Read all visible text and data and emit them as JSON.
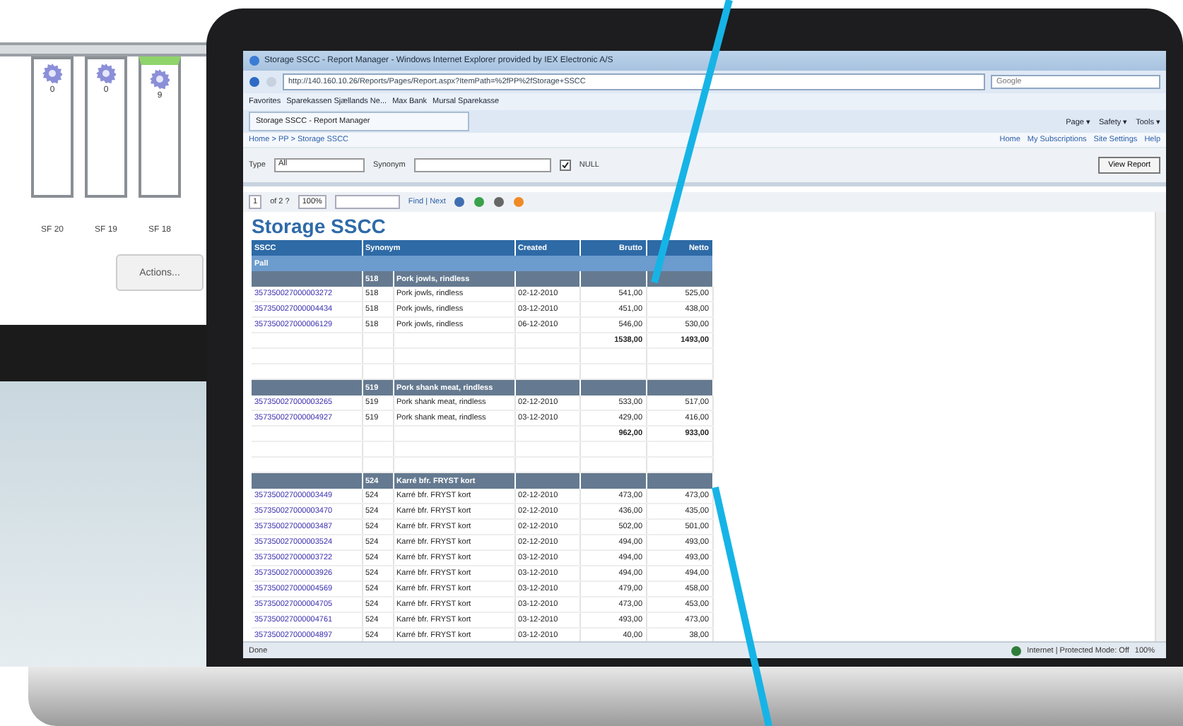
{
  "monitor": {
    "slots": [
      {
        "label": "SF 20",
        "count": "0",
        "selected": false
      },
      {
        "label": "SF 19",
        "count": "0",
        "selected": false
      },
      {
        "label": "SF 18",
        "count": "9",
        "selected": true
      }
    ],
    "actions_button": "Actions..."
  },
  "browser": {
    "title": "Storage SSCC - Report Manager - Windows Internet Explorer provided by IEX Electronic A/S",
    "address": "http://140.160.10.26/Reports/Pages/Report.aspx?ItemPath=%2fPP%2fStorage+SSCC",
    "search_placeholder": "Google",
    "favorites": [
      "Favorites",
      "Sparekassen Sjællands Ne...",
      "Max Bank",
      "Mursal Sparekasse"
    ],
    "tab": "Storage SSCC - Report Manager",
    "commands": [
      "Page ▾",
      "Safety ▾",
      "Tools ▾"
    ],
    "breadcrumb": "Home > PP > Storage SSCC",
    "links": [
      "Home",
      "My Subscriptions",
      "Site Settings",
      "Help"
    ],
    "params": {
      "type_label": "Type",
      "type_value": "All",
      "synonym_label": "Synonym",
      "null_label": "NULL",
      "null_checked": true,
      "view_button": "View Report"
    },
    "report_toolbar": {
      "page": "1",
      "of": "of 2 ?",
      "zoom": "100%",
      "find": "Find | Next"
    },
    "status": {
      "left": "Done",
      "zone": "Internet | Protected Mode: Off",
      "zoom": "100%"
    }
  },
  "report": {
    "title": "Storage SSCC",
    "columns": [
      "SSCC",
      "Synonym",
      "Created",
      "Brutto",
      "Netto"
    ],
    "group": "Pall",
    "subgroups": [
      {
        "code": "518",
        "name": "Pork jowls, rindless",
        "total": [
          "1538,00",
          "1493,00"
        ],
        "rows": [
          [
            "357350027000003272",
            "518",
            "Pork jowls, rindless",
            "02-12-2010",
            "541,00",
            "525,00"
          ],
          [
            "357350027000004434",
            "518",
            "Pork jowls, rindless",
            "03-12-2010",
            "451,00",
            "438,00"
          ],
          [
            "357350027000006129",
            "518",
            "Pork jowls, rindless",
            "06-12-2010",
            "546,00",
            "530,00"
          ]
        ]
      },
      {
        "code": "519",
        "name": "Pork shank meat, rindless",
        "total": [
          "962,00",
          "933,00"
        ],
        "rows": [
          [
            "357350027000003265",
            "519",
            "Pork shank meat, rindless",
            "02-12-2010",
            "533,00",
            "517,00"
          ],
          [
            "357350027000004927",
            "519",
            "Pork shank meat, rindless",
            "03-12-2010",
            "429,00",
            "416,00"
          ]
        ]
      },
      {
        "code": "524",
        "name": "Karré bfr. FRYST kort",
        "rows": [
          [
            "357350027000003449",
            "524",
            "Karré bfr. FRYST kort",
            "02-12-2010",
            "473,00",
            "473,00"
          ],
          [
            "357350027000003470",
            "524",
            "Karré bfr. FRYST kort",
            "02-12-2010",
            "436,00",
            "435,00"
          ],
          [
            "357350027000003487",
            "524",
            "Karré bfr. FRYST kort",
            "02-12-2010",
            "502,00",
            "501,00"
          ],
          [
            "357350027000003524",
            "524",
            "Karré bfr. FRYST kort",
            "02-12-2010",
            "494,00",
            "493,00"
          ],
          [
            "357350027000003722",
            "524",
            "Karré bfr. FRYST kort",
            "03-12-2010",
            "494,00",
            "493,00"
          ],
          [
            "357350027000003926",
            "524",
            "Karré bfr. FRYST kort",
            "03-12-2010",
            "494,00",
            "494,00"
          ],
          [
            "357350027000004569",
            "524",
            "Karré bfr. FRYST kort",
            "03-12-2010",
            "479,00",
            "458,00"
          ],
          [
            "357350027000004705",
            "524",
            "Karré bfr. FRYST kort",
            "03-12-2010",
            "473,00",
            "453,00"
          ],
          [
            "357350027000004761",
            "524",
            "Karré bfr. FRYST kort",
            "03-12-2010",
            "493,00",
            "473,00"
          ],
          [
            "357350027000004897",
            "524",
            "Karré bfr. FRYST kort",
            "03-12-2010",
            "40,00",
            "38,00"
          ]
        ]
      }
    ]
  }
}
